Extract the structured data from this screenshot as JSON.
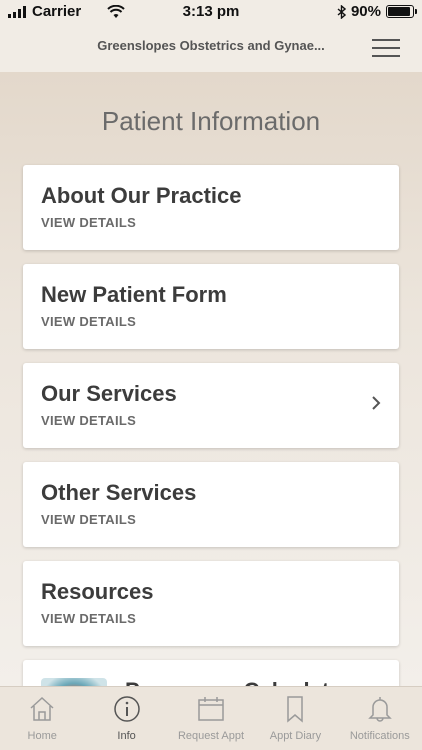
{
  "status_bar": {
    "carrier": "Carrier",
    "time": "3:13 pm",
    "battery_percent": "90%",
    "battery_level": 0.9
  },
  "nav": {
    "title": "Greenslopes Obstetrics and Gynae..."
  },
  "page": {
    "title": "Patient Information"
  },
  "cards": [
    {
      "title": "About Our Practice",
      "subtitle": "VIEW DETAILS"
    },
    {
      "title": "New Patient Form",
      "subtitle": "VIEW DETAILS"
    },
    {
      "title": "Our Services",
      "subtitle": "VIEW DETAILS",
      "chevron": true
    },
    {
      "title": "Other Services",
      "subtitle": "VIEW DETAILS"
    },
    {
      "title": "Resources",
      "subtitle": "VIEW DETAILS"
    },
    {
      "title": "Pregnancy Calculator"
    }
  ],
  "tabs": [
    {
      "label": "Home",
      "icon": "home-icon"
    },
    {
      "label": "Info",
      "icon": "info-icon",
      "active": true
    },
    {
      "label": "Request Appt",
      "icon": "calendar-icon"
    },
    {
      "label": "Appt Diary",
      "icon": "bookmark-icon"
    },
    {
      "label": "Notifications",
      "icon": "bell-icon"
    }
  ],
  "colors": {
    "background": "#ece5dc",
    "card": "#ffffff",
    "text_dark": "#3c3c3c",
    "text_muted": "#6a6a6a",
    "tab_inactive": "#9a9a9a"
  }
}
